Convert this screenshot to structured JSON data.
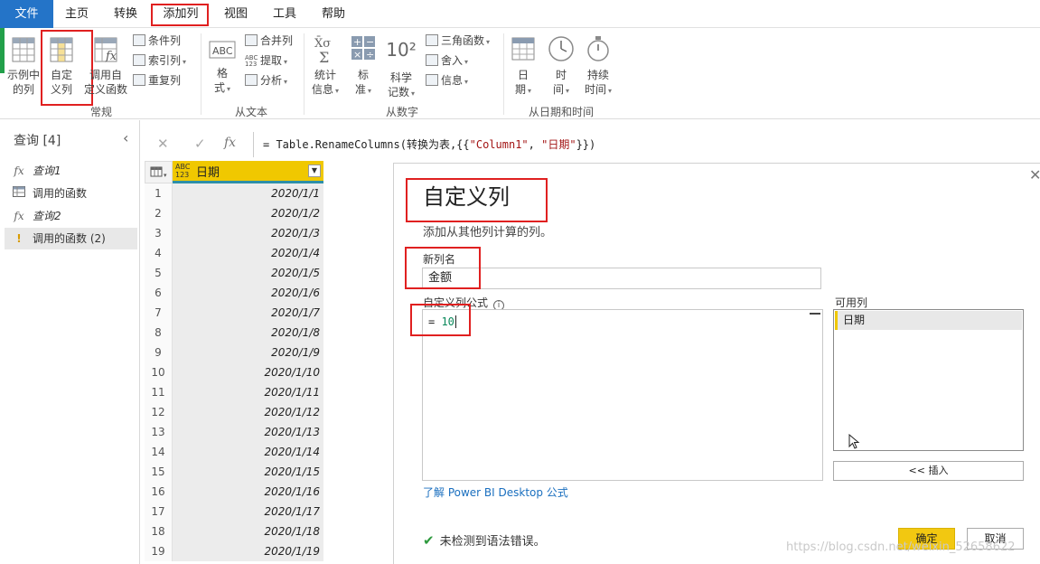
{
  "tabs": [
    "文件",
    "主页",
    "转换",
    "添加列",
    "视图",
    "工具",
    "帮助"
  ],
  "ribbon": {
    "general": {
      "example_col": [
        "示例中",
        "的列"
      ],
      "custom_col": [
        "自定",
        "义列"
      ],
      "invoke_fn": [
        "调用自",
        "定义函数"
      ],
      "conditional": "条件列",
      "index": "索引列",
      "duplicate": "重复列",
      "label": "常规"
    },
    "text": {
      "format": [
        "格",
        "式"
      ],
      "merge": "合并列",
      "extract": "提取",
      "parse": "分析",
      "label": "从文本"
    },
    "number": {
      "statistics": [
        "统计",
        "信息"
      ],
      "standard": [
        "标",
        "准"
      ],
      "scientific": [
        "科学",
        "记数"
      ],
      "scientific_icon": "10²",
      "trig": "三角函数",
      "rounding": "舍入",
      "info": "信息",
      "label": "从数字"
    },
    "datetime": {
      "date": [
        "日",
        "期"
      ],
      "time": [
        "时",
        "间"
      ],
      "duration": [
        "持续",
        "时间"
      ],
      "label": "从日期和时间"
    }
  },
  "queries": {
    "title": "查询 [4]",
    "items": [
      "查询1",
      "调用的函数",
      "查询2",
      "调用的函数 (2)"
    ]
  },
  "formula_bar": {
    "fx": "fx",
    "prefix": "= Table.RenameColumns(转换为表,{{",
    "str1": "\"Column1\"",
    "mid": ", ",
    "str2": "\"日期\"",
    "suffix": "}})"
  },
  "grid": {
    "type_badge": "ABC\n123",
    "column": "日期",
    "row_numbers": [
      "1",
      "2",
      "3",
      "4",
      "5",
      "6",
      "7",
      "8",
      "9",
      "10",
      "11",
      "12",
      "13",
      "14",
      "15",
      "16",
      "17",
      "18",
      "19"
    ],
    "values": [
      "2020/1/1",
      "2020/1/2",
      "2020/1/3",
      "2020/1/4",
      "2020/1/5",
      "2020/1/6",
      "2020/1/7",
      "2020/1/8",
      "2020/1/9",
      "2020/1/10",
      "2020/1/11",
      "2020/1/12",
      "2020/1/13",
      "2020/1/14",
      "2020/1/15",
      "2020/1/16",
      "2020/1/17",
      "2020/1/18",
      "2020/1/19"
    ]
  },
  "dialog": {
    "title": "自定义列",
    "subtitle": "添加从其他列计算的列。",
    "new_col_label": "新列名",
    "new_col_value": "金额",
    "formula_label": "自定义列公式",
    "info_icon": "i",
    "formula_prefix": "= ",
    "formula_num": "10",
    "available_label": "可用列",
    "available_items": [
      "日期"
    ],
    "insert_btn": "<< 插入",
    "learn_link": "了解 Power BI Desktop 公式",
    "status": "未检测到语法错误。",
    "ok": "确定",
    "cancel": "取消"
  },
  "watermark": "https://blog.csdn.net/weixin_52658622",
  "colors": {
    "file_tab": "#2474c8",
    "highlight_red": "#e02020",
    "column_header": "#f0c800",
    "ok_button": "#f2c811",
    "link": "#1a6fbf"
  }
}
